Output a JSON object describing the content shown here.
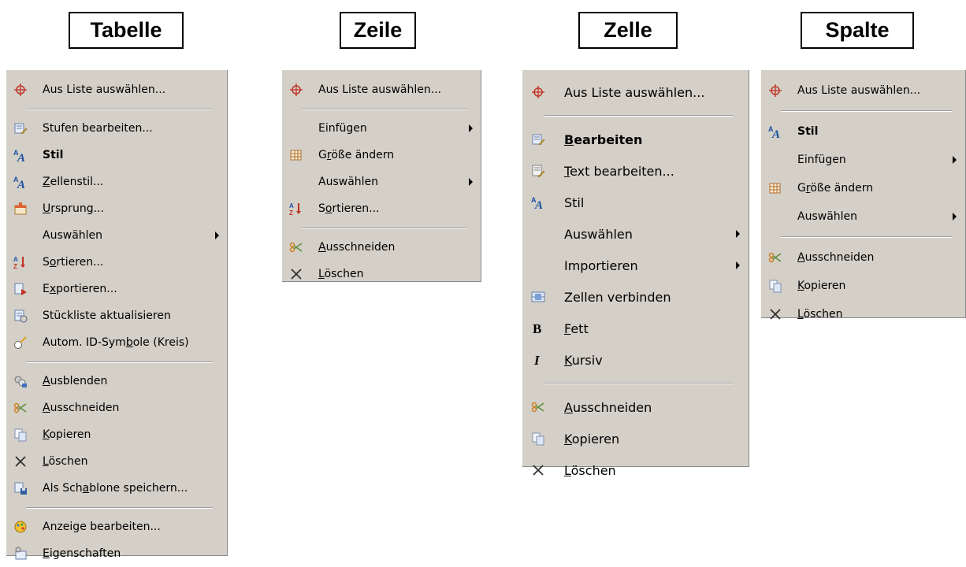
{
  "titles": {
    "tabelle": "Tabelle",
    "zeile": "Zeile",
    "zelle": "Zelle",
    "spalte": "Spalte"
  },
  "menus": {
    "tabelle": [
      {
        "label": "Aus Liste auswählen...",
        "icon": "crosshair-icon"
      },
      {
        "sep": true
      },
      {
        "label": "Stufen bearbeiten...",
        "icon": "edit-levels-icon"
      },
      {
        "label": "Stil",
        "icon": "style-icon",
        "bold": true
      },
      {
        "label": "Zellenstil...",
        "icon": "style-icon",
        "ul": "Z"
      },
      {
        "label": "Ursprung...",
        "icon": "origin-icon",
        "ul": "U"
      },
      {
        "label": "Auswählen",
        "submenu": true
      },
      {
        "label": "Sortieren...",
        "icon": "sort-icon",
        "ul": "o"
      },
      {
        "label": "Exportieren...",
        "icon": "export-icon",
        "ul": "x"
      },
      {
        "label": "Stückliste aktualisieren",
        "icon": "update-bom-icon"
      },
      {
        "label": "Autom. ID-Symbole (Kreis)",
        "icon": "balloon-icon",
        "ul": "b"
      },
      {
        "sep": true
      },
      {
        "label": "Ausblenden",
        "icon": "hide-icon",
        "ul": "A"
      },
      {
        "label": "Ausschneiden",
        "icon": "cut-icon",
        "ul": "A"
      },
      {
        "label": "Kopieren",
        "icon": "copy-icon",
        "ul": "K"
      },
      {
        "label": "Löschen",
        "icon": "delete-icon",
        "ul": "L"
      },
      {
        "label": "Als Schablone speichern...",
        "icon": "save-template-icon",
        "ul": "a"
      },
      {
        "sep": true
      },
      {
        "label": "Anzeige bearbeiten...",
        "icon": "edit-display-icon"
      },
      {
        "label": "Eigenschaften",
        "icon": "properties-icon",
        "ul": "E"
      }
    ],
    "zeile": [
      {
        "label": "Aus Liste auswählen...",
        "icon": "crosshair-icon"
      },
      {
        "sep": true
      },
      {
        "label": "Einfügen",
        "submenu": true
      },
      {
        "label": "Größe ändern",
        "icon": "resize-icon",
        "ul": "r"
      },
      {
        "label": "Auswählen",
        "submenu": true
      },
      {
        "label": "Sortieren...",
        "icon": "sort-icon",
        "ul": "o"
      },
      {
        "sep": true
      },
      {
        "label": "Ausschneiden",
        "icon": "cut-icon",
        "ul": "A"
      },
      {
        "label": "Löschen",
        "icon": "delete-icon",
        "ul": "L"
      }
    ],
    "zelle": [
      {
        "label": "Aus Liste auswählen...",
        "icon": "crosshair-icon"
      },
      {
        "sep": true
      },
      {
        "label": "Bearbeiten",
        "icon": "edit-levels-icon",
        "bold": true,
        "ul": "B"
      },
      {
        "label": "Text bearbeiten...",
        "icon": "edit-text-icon",
        "ul": "T"
      },
      {
        "label": "Stil",
        "icon": "style-icon"
      },
      {
        "label": "Auswählen",
        "submenu": true
      },
      {
        "label": "Importieren",
        "submenu": true
      },
      {
        "label": "Zellen verbinden",
        "icon": "merge-cells-icon"
      },
      {
        "label": "Fett",
        "icon": "bold-icon",
        "ul": "F"
      },
      {
        "label": "Kursiv",
        "icon": "italic-icon",
        "ul": "K"
      },
      {
        "sep": true
      },
      {
        "label": "Ausschneiden",
        "icon": "cut-icon",
        "ul": "A"
      },
      {
        "label": "Kopieren",
        "icon": "copy-icon",
        "ul": "K"
      },
      {
        "label": "Löschen",
        "icon": "delete-icon",
        "ul": "L"
      }
    ],
    "spalte": [
      {
        "label": "Aus Liste auswählen...",
        "icon": "crosshair-icon"
      },
      {
        "sep": true
      },
      {
        "label": "Stil",
        "icon": "style-icon",
        "bold": true
      },
      {
        "label": "Einfügen",
        "submenu": true
      },
      {
        "label": "Größe ändern",
        "icon": "resize-icon",
        "ul": "r"
      },
      {
        "label": "Auswählen",
        "submenu": true
      },
      {
        "sep": true
      },
      {
        "label": "Ausschneiden",
        "icon": "cut-icon",
        "ul": "A"
      },
      {
        "label": "Kopieren",
        "icon": "copy-icon",
        "ul": "K"
      },
      {
        "label": "Löschen",
        "icon": "delete-icon",
        "ul": "L"
      }
    ]
  }
}
